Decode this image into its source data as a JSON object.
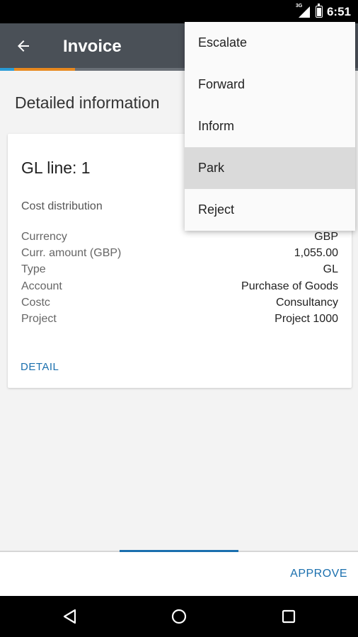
{
  "status_bar": {
    "network": "3G",
    "time": "6:51",
    "battery_level": 0.8
  },
  "app_bar": {
    "title": "Invoice",
    "back_icon": "arrow-left-icon"
  },
  "content": {
    "section_title": "Detailed information",
    "card": {
      "title": "GL line: 1",
      "subtitle": "Cost distribution",
      "rows": [
        {
          "label": "Currency",
          "value": "GBP"
        },
        {
          "label": "Curr. amount (GBP)",
          "value": "1,055.00"
        },
        {
          "label": "Type",
          "value": "GL"
        },
        {
          "label": "Account",
          "value": "Purchase of Goods"
        },
        {
          "label": "Costc",
          "value": "Consultancy"
        },
        {
          "label": "Project",
          "value": "Project 1000"
        }
      ],
      "detail_link": "DETAIL"
    }
  },
  "bottom_bar": {
    "approve_label": "APPROVE"
  },
  "overflow_menu": {
    "items": [
      {
        "label": "Escalate"
      },
      {
        "label": "Forward"
      },
      {
        "label": "Inform"
      },
      {
        "label": "Park",
        "highlighted": true
      },
      {
        "label": "Reject"
      }
    ]
  },
  "colors": {
    "app_bar": "#4a5057",
    "accent_blue": "#2a9bd6",
    "accent_orange": "#e8891f",
    "link": "#1a6fae"
  },
  "nav_bar": {
    "icons": [
      "back-triangle-icon",
      "home-circle-icon",
      "recents-square-icon"
    ]
  }
}
